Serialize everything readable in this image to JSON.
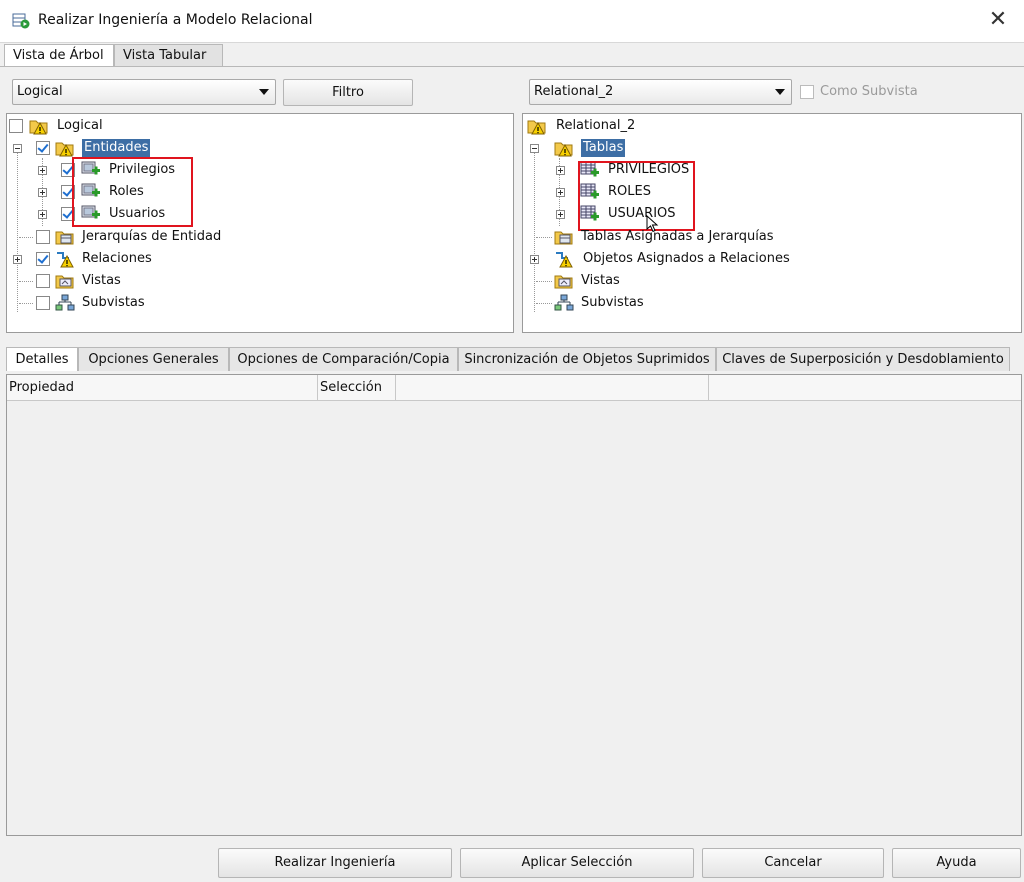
{
  "window": {
    "title": "Realizar Ingeniería a Modelo Relacional",
    "close_icon": "close-icon"
  },
  "top_tabs": [
    {
      "label": "Vista de Árbol",
      "active": true
    },
    {
      "label": "Vista Tabular",
      "active": false
    }
  ],
  "left": {
    "combo_value": "Logical",
    "filter_button": "Filtro",
    "tree": {
      "root": "Logical",
      "entidades": "Entidades",
      "entities": [
        "Privilegios",
        "Roles",
        "Usuarios"
      ],
      "jerarquias": "Jerarquías de Entidad",
      "relaciones": "Relaciones",
      "vistas": "Vistas",
      "subvistas": "Subvistas"
    }
  },
  "right": {
    "combo_value": "Relational_2",
    "subview_checkbox": "Como Subvista",
    "tree": {
      "root": "Relational_2",
      "tablas": "Tablas",
      "tables": [
        "PRIVILEGIOS",
        "ROLES",
        "USUARIOS"
      ],
      "tablas_asignadas": "Tablas Asignadas a Jerarquías",
      "objetos_asignados": "Objetos Asignados a Relaciones",
      "vistas": "Vistas",
      "subvistas": "Subvistas"
    }
  },
  "bottom_tabs": [
    "Detalles",
    "Opciones Generales",
    "Opciones de Comparación/Copia",
    "Sincronización de Objetos Suprimidos",
    "Claves de Superposición y Desdoblamiento"
  ],
  "grid_headers": {
    "propiedad": "Propiedad",
    "seleccion": "Selección"
  },
  "buttons": {
    "engineer": "Realizar Ingeniería",
    "apply": "Aplicar Selección",
    "cancel": "Cancelar",
    "help": "Ayuda"
  },
  "colors": {
    "selection": "#3d6ea5",
    "highlight_box": "#e0141e",
    "check": "#1e6fd0"
  }
}
